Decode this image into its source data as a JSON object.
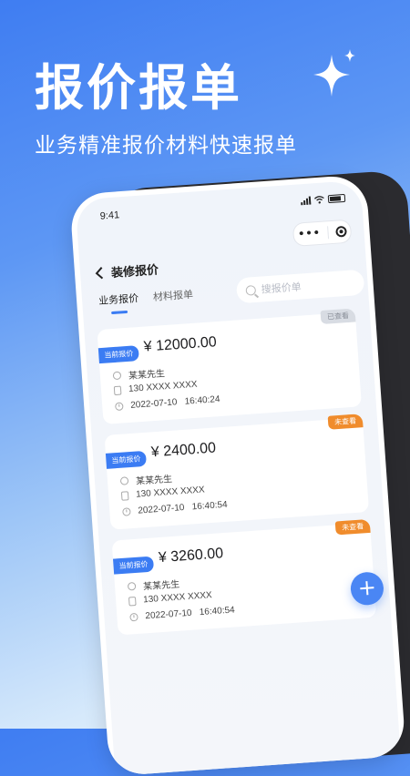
{
  "promo": {
    "title": "报价报单",
    "subtitle": "业务精准报价材料快速报单"
  },
  "status_bar": {
    "time": "9:41"
  },
  "nav": {
    "back_icon": "chevron-left-icon",
    "title": "装修报价",
    "more": "•••"
  },
  "tabs": [
    {
      "label": "业务报价",
      "active": true
    },
    {
      "label": "材料报单",
      "active": false
    }
  ],
  "search": {
    "placeholder": "搜报价单"
  },
  "cards": [
    {
      "badge": "已查看",
      "badge_type": "viewed",
      "tag": "当前报价",
      "price": "¥ 12000.00",
      "name": "某某先生",
      "phone": "130 XXXX XXXX",
      "datetime": "2022-07-10   16:40:24"
    },
    {
      "badge": "未查看",
      "badge_type": "unviewed",
      "tag": "当前报价",
      "price": "¥ 2400.00",
      "name": "某某先生",
      "phone": "130 XXXX XXXX",
      "datetime": "2022-07-10   16:40:54"
    },
    {
      "badge": "未查看",
      "badge_type": "unviewed",
      "tag": "当前报价",
      "price": "¥ 3260.00",
      "name": "某某先生",
      "phone": "130 XXXX XXXX",
      "datetime": "2022-07-10   16:40:54"
    }
  ],
  "fab": {
    "label": "+"
  },
  "colors": {
    "accent": "#3b7cf3",
    "badge_unviewed": "#f08c2c",
    "badge_viewed": "#d8dce3"
  }
}
